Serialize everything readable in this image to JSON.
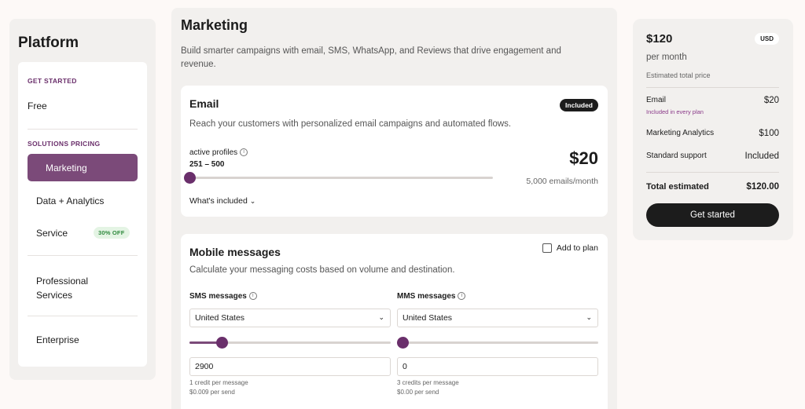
{
  "sidebar": {
    "title": "Platform",
    "section_get_started": "GET STARTED",
    "free": "Free",
    "section_solutions": "SOLUTIONS PRICING",
    "marketing": "Marketing",
    "data_analytics": "Data + Analytics",
    "service": "Service",
    "service_badge": "30% OFF",
    "professional_line1": "Professional",
    "professional_line2": "Services",
    "enterprise": "Enterprise"
  },
  "main": {
    "title": "Marketing",
    "description": "Build smarter campaigns with email, SMS, WhatsApp, and Reviews that drive engagement and revenue."
  },
  "email_card": {
    "title": "Email",
    "badge": "Included",
    "subtitle": "Reach your customers with personalized email campaigns and automated flows.",
    "profiles_label": "active profiles",
    "profiles_range": "251 – 500",
    "slider_fraction": 0.0,
    "price": "$20",
    "price_note": "5,000 emails/month",
    "whats_included": "What's included"
  },
  "mobile_card": {
    "title": "Mobile messages",
    "add_to_plan": "Add to plan",
    "subtitle": "Calculate your messaging costs based on volume and destination.",
    "sms": {
      "label": "SMS messages",
      "country": "United States",
      "slider_fraction": 0.16,
      "value": "2900",
      "note1": "1 credit per message",
      "note2": "$0.009 per send"
    },
    "mms": {
      "label": "MMS messages",
      "country": "United States",
      "slider_fraction": 0.0,
      "value": "0",
      "note1": "3 credits per message",
      "note2": "$0.00 per send"
    }
  },
  "summary": {
    "price": "$120",
    "currency": "USD",
    "per_month": "per month",
    "estimated_label": "Estimated total price",
    "rows": [
      {
        "label": "Email",
        "value": "$20",
        "sub": "Included in every plan"
      },
      {
        "label": "Marketing Analytics",
        "value": "$100"
      },
      {
        "label": "Standard support",
        "value": "Included"
      }
    ],
    "total_label": "Total estimated",
    "total_value": "$120.00",
    "cta": "Get started"
  },
  "colors": {
    "accent": "#7b4a79",
    "accent_dark": "#6a2f6b",
    "dark": "#1c1c1c",
    "panel": "#f2f0ee",
    "badge_green": "#2f8a3e"
  }
}
